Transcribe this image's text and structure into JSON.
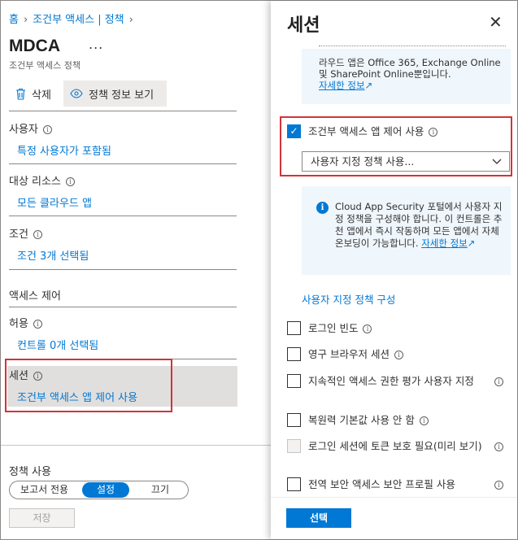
{
  "breadcrumb": {
    "home": "홈",
    "conditional_access": "조건부 액세스 | 정책"
  },
  "blade": {
    "title": "MDCA",
    "subtitle": "조건부 액세스 정책",
    "more_label": "...",
    "toolbar": {
      "delete_label": "삭제",
      "view_info_label": "정책 정보 보기"
    },
    "sections": {
      "users": {
        "label": "사용자",
        "value": "특정 사용자가 포함됨"
      },
      "target": {
        "label": "대상 리소스",
        "value": "모든 클라우드 앱"
      },
      "conditions": {
        "label": "조건",
        "value": "조건 3개 선택됨"
      },
      "access_control": {
        "label": "액세스 제어"
      },
      "grant": {
        "label": "허용",
        "value": "컨트롤 0개 선택됨"
      },
      "session": {
        "label": "세션",
        "value": "조건부 액세스 앱 제어 사용"
      }
    },
    "enable_policy": {
      "label": "정책 사용",
      "options": [
        "보고서 전용",
        "설정",
        "끄기"
      ],
      "selected": "설정"
    },
    "save_label": "저장"
  },
  "panel": {
    "title": "세션",
    "close_label": "✕",
    "info_top": {
      "text": "라우드 앱은 Office 365, Exchange Online 및 SharePoint Online뿐입니다.",
      "link": "자세한 정보"
    },
    "app_control": {
      "label": "조건부 액세스 앱 제어 사용",
      "checked": true,
      "dropdown_value": "사용자 지정 정책 사용..."
    },
    "info_mcas": {
      "text": "Cloud App Security 포털에서 사용자 지정 정책을 구성해야 합니다. 이 컨트롤은 추천 앱에서 즉시 작동하며 모든 앱에서 자체 온보딩이 가능합니다.",
      "link": "자세한 정보"
    },
    "configure_link": "사용자 지정 정책 구성",
    "options": [
      {
        "label": "로그인 빈도",
        "checked": false,
        "disabled": false
      },
      {
        "label": "영구 브라우저 세션",
        "checked": false,
        "disabled": false
      },
      {
        "label": "지속적인 액세스 권한 평가 사용자 지정",
        "checked": false,
        "disabled": false
      },
      {
        "label": "복원력 기본값 사용 안 함",
        "checked": false,
        "disabled": false
      },
      {
        "label": "로그인 세션에 토큰 보호 필요(미리 보기)",
        "checked": false,
        "disabled": true
      },
      {
        "label": "전역 보안 액세스 보안 프로필 사용",
        "checked": false,
        "disabled": false
      }
    ],
    "select_label": "선택"
  },
  "colors": {
    "accent": "#0078d4",
    "highlight": "#d13438"
  }
}
